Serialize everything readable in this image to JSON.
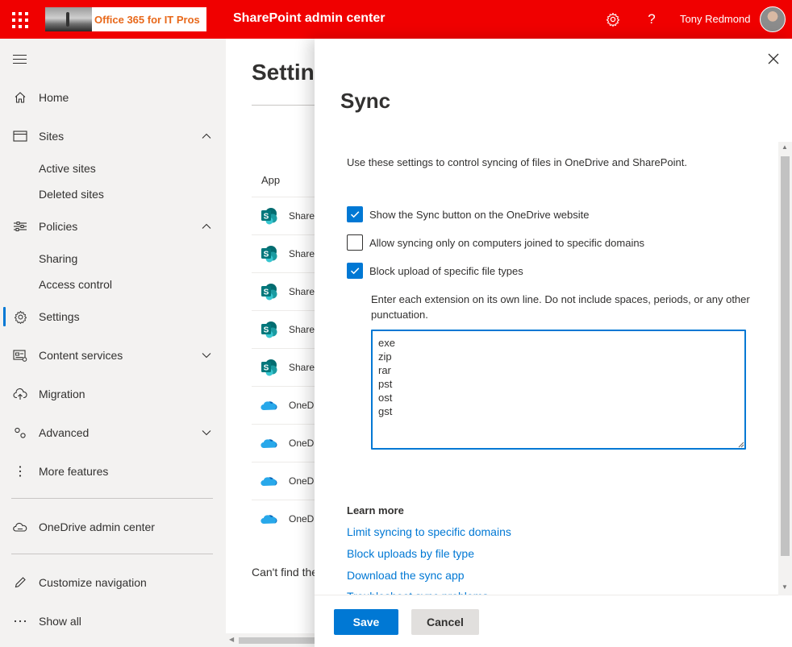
{
  "topbar": {
    "app_launcher": "app-launcher-icon",
    "org_logo_text": "Office 365 for IT Pros",
    "app_title": "SharePoint admin center",
    "settings_icon": "gear-icon",
    "help_icon": "help-icon",
    "user_name": "Tony Redmond",
    "colors": {
      "bar": "#f00000",
      "logo_text": "#e8681a"
    }
  },
  "leftnav": {
    "items": [
      {
        "label": "Home",
        "icon": "home-icon"
      },
      {
        "label": "Sites",
        "icon": "sites-icon",
        "expanded": true,
        "children": [
          "Active sites",
          "Deleted sites"
        ]
      },
      {
        "label": "Policies",
        "icon": "policies-icon",
        "expanded": true,
        "children": [
          "Sharing",
          "Access control"
        ]
      },
      {
        "label": "Settings",
        "icon": "gear-icon",
        "active": true
      },
      {
        "label": "Content services",
        "icon": "content-services-icon",
        "expanded": false
      },
      {
        "label": "Migration",
        "icon": "cloud-upload-icon"
      },
      {
        "label": "Advanced",
        "icon": "advanced-icon",
        "expanded": false
      },
      {
        "label": "More features",
        "icon": "more-icon"
      }
    ],
    "onedrive_admin": "OneDrive admin center",
    "customize": "Customize navigation",
    "show_all": "Show all",
    "accent": "#0078d4"
  },
  "page": {
    "title": "Settin",
    "column_header": "App",
    "rows": [
      {
        "app": "SharePoint",
        "icon": "sharepoint-icon"
      },
      {
        "app": "SharePoint",
        "icon": "sharepoint-icon"
      },
      {
        "app": "SharePoint",
        "icon": "sharepoint-icon"
      },
      {
        "app": "SharePoint",
        "icon": "sharepoint-icon"
      },
      {
        "app": "SharePoint",
        "icon": "sharepoint-icon"
      },
      {
        "app": "OneDrive",
        "icon": "onedrive-icon"
      },
      {
        "app": "OneDrive",
        "icon": "onedrive-icon"
      },
      {
        "app": "OneDrive",
        "icon": "onedrive-icon"
      },
      {
        "app": "OneDrive",
        "icon": "onedrive-icon"
      }
    ],
    "cant_find": "Can't find the"
  },
  "panel": {
    "title": "Sync",
    "intro": "Use these settings to control syncing of files in OneDrive and SharePoint.",
    "options": [
      {
        "label": "Show the Sync button on the OneDrive website",
        "checked": true
      },
      {
        "label": "Allow syncing only on computers joined to specific domains",
        "checked": false
      },
      {
        "label": "Block upload of specific file types",
        "checked": true
      }
    ],
    "extension_help": "Enter each extension on its own line. Do not include spaces, periods, or any other punctuation.",
    "extensions": "exe\nzip\nrar\npst\nost\ngst",
    "learn_more": {
      "title": "Learn more",
      "links": [
        "Limit syncing to specific domains",
        "Block uploads by file type",
        "Download the sync app",
        "Troubleshoot sync problems"
      ]
    },
    "save_label": "Save",
    "cancel_label": "Cancel",
    "colors": {
      "primary": "#0078d4",
      "default_button": "#e1dfdd"
    }
  }
}
